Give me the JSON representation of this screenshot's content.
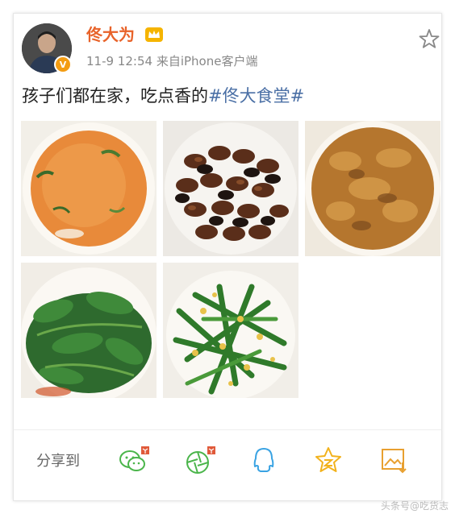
{
  "post": {
    "username": "佟大为",
    "time": "11-9 12:54",
    "source": "来自iPhone客户端",
    "text": "孩子们都在家，吃点香的",
    "topic": "#佟大食堂#"
  },
  "photos": [
    {
      "name": "photo-soup",
      "subject": "tomato soup"
    },
    {
      "name": "photo-silkworm-pupae",
      "subject": "fried silkworm pupae"
    },
    {
      "name": "photo-braised-dish",
      "subject": "braised dish"
    },
    {
      "name": "photo-greens",
      "subject": "stir-fried greens"
    },
    {
      "name": "photo-green-beans",
      "subject": "green beans with egg"
    }
  ],
  "share": {
    "label": "分享到",
    "icons": [
      "wechat-icon",
      "moments-icon",
      "qq-icon",
      "qzone-icon",
      "save-image-icon"
    ]
  },
  "colors": {
    "username": "#e8632a",
    "topic": "#4a6fa5",
    "meta": "#888888"
  },
  "watermark": "头条号@吃货志"
}
